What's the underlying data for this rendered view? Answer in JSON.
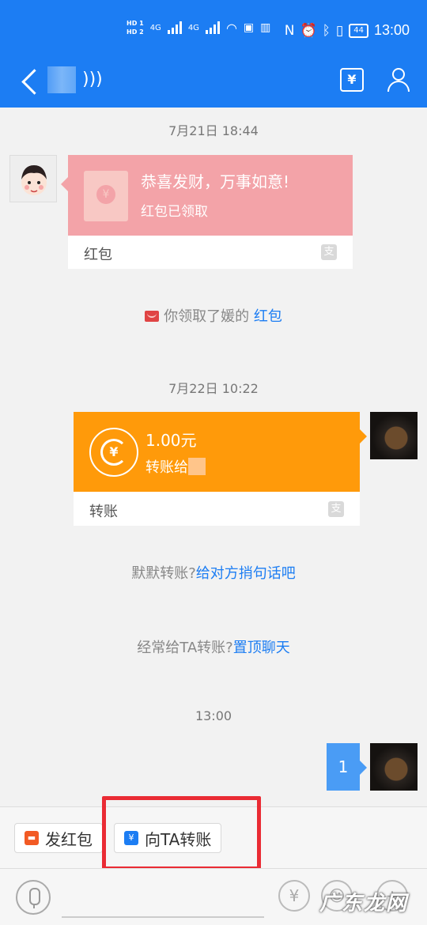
{
  "status_bar": {
    "left_hd1": "HD 1",
    "left_hd2": "HD 2",
    "net1": "4G",
    "net2": "4G",
    "battery": "44",
    "time": "13:00"
  },
  "header": {
    "back_icon": "chevron-left-icon",
    "ear_icon": "hearing-icon",
    "transfer_icon": "transfer-icon",
    "user_icon": "user-settings-icon",
    "color": "#1c7df3"
  },
  "messages": {
    "ts1": "7月21日 18:44",
    "red_packet": {
      "title": "恭喜发财，万事如意!",
      "subtitle": "红包已领取",
      "footer": "红包",
      "color": "#f3a3a8"
    },
    "received_note_pre": "你领取了媛的",
    "received_note_link": "红包",
    "ts2": "7月22日 10:22",
    "transfer": {
      "amount": "1.00元",
      "to_label": "转账给",
      "footer": "转账",
      "color": "#ff9a0a"
    },
    "tip1_pre": "默默转账?",
    "tip1_link": "给对方捎句话吧",
    "tip2_pre": "经常给TA转账?",
    "tip2_link": "置顶聊天",
    "ts3": "13:00",
    "text_msg": "1"
  },
  "quick_actions": {
    "send_red_packet": "发红包",
    "transfer_to_ta": "向TA转账"
  },
  "input_bar": {
    "watermark": "广东龙网"
  }
}
